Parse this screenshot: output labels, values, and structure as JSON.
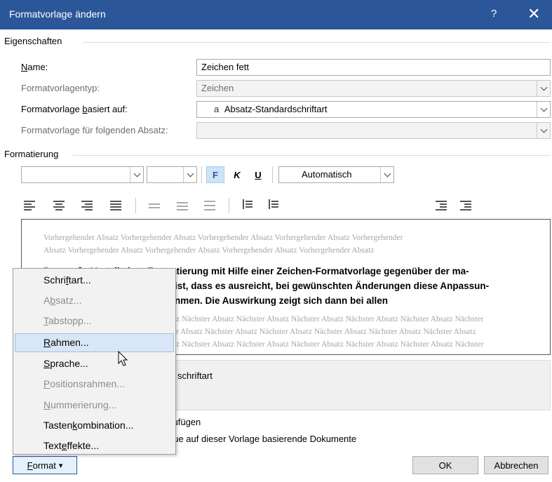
{
  "window": {
    "title": "Formatvorlage ändern",
    "help": "?",
    "close": "✕"
  },
  "eigenschaften": {
    "section": "Eigenschaften",
    "name_label": "Name:",
    "name_value": "Zeichen fett",
    "typ_label": "Formatvorlagentyp:",
    "typ_value": "Zeichen",
    "basiert_label": "Formatvorlage basiert auf:",
    "basiert_icon": "a",
    "basiert_value": "Absatz-Standardschriftart",
    "folgend_label": "Formatvorlage für folgenden Absatz:",
    "folgend_value": ""
  },
  "formatierung": {
    "section": "Formatierung",
    "font_value": "",
    "size_value": "",
    "bold": "F",
    "italic": "K",
    "underline": "U",
    "color_value": "Automatisch"
  },
  "preview": {
    "previous_1": "Vorhergehender Absatz Vorhergehender Absatz Vorhergehender Absatz Vorhergehender Absatz Vorhergehender",
    "previous_2": "Absatz Vorhergehender Absatz Vorhergehender Absatz Vorhergehender Absatz Vorhergehender Absatz",
    "sample_1": "Der große Vorteil einer Formatierung mit Hilfe einer Zeichen-Formatvorlage gegenüber der ma-",
    "sample_2": "ist, dass es ausreicht, bei gewünschten Änderungen diese Anpassun-",
    "sample_3": "nmen. Die Auswirkung zeigt sich dann bei allen",
    "next_1": "z Nächster Absatz Nächster Absatz Nächster Absatz Nächster Absatz Nächster Absatz Nächster",
    "next_2": "r Absatz Nächster Absatz Nächster Absatz Nächster Absatz Nächster Absatz Nächster Absatz",
    "next_3": "z Nächster Absatz Nächster Absatz Nächster Absatz Nächster Absatz Nächster Absatz Nächster"
  },
  "description": {
    "text": "schriftart"
  },
  "options": {
    "add_gallery": "zufügen",
    "new_docs": "eue auf dieser Vorlage basierende Dokumente"
  },
  "menu": {
    "items": [
      {
        "pre": "Schri",
        "key": "f",
        "post": "tart...",
        "disabled": false
      },
      {
        "pre": "A",
        "key": "b",
        "post": "satz...",
        "disabled": true
      },
      {
        "pre": "",
        "key": "T",
        "post": "abstopp...",
        "disabled": true
      },
      {
        "pre": "",
        "key": "R",
        "post": "ahmen...",
        "disabled": false
      },
      {
        "pre": "",
        "key": "S",
        "post": "prache...",
        "disabled": false
      },
      {
        "pre": "",
        "key": "P",
        "post": "ositionsrahmen...",
        "disabled": true
      },
      {
        "pre": "",
        "key": "N",
        "post": "ummerierung...",
        "disabled": true
      },
      {
        "pre": "Tasten",
        "key": "k",
        "post": "ombination...",
        "disabled": false
      },
      {
        "pre": "Text",
        "key": "e",
        "post": "ffekte...",
        "disabled": false
      }
    ]
  },
  "buttons": {
    "format_key": "F",
    "format_rest": "ormat",
    "format_arrow": "▾",
    "ok": "OK",
    "cancel": "Abbrechen"
  },
  "colors": {
    "titlebar": "#2b579a",
    "menu_hover": "#d8e6f5"
  }
}
